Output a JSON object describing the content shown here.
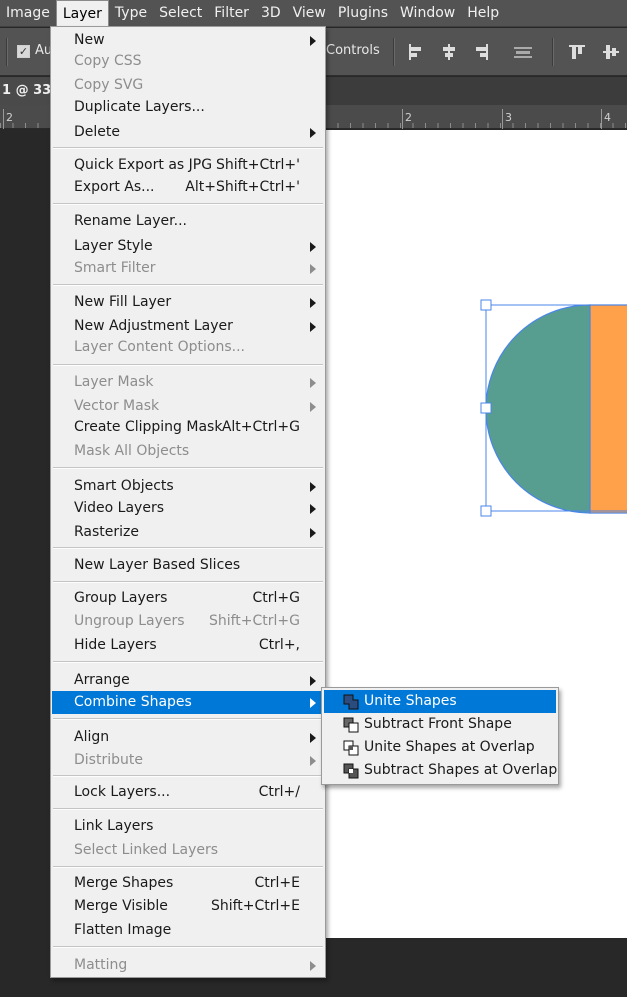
{
  "menubar": {
    "items": [
      "Image",
      "Layer",
      "Type",
      "Select",
      "Filter",
      "3D",
      "View",
      "Plugins",
      "Window",
      "Help"
    ],
    "active_index": 1
  },
  "options_bar": {
    "auto_select_label": "Au",
    "auto_select_checked": true,
    "transform_controls_label": "Controls"
  },
  "document": {
    "tab_title": "1 @ 33."
  },
  "ruler": {
    "labels": [
      "2",
      "2",
      "3",
      "4"
    ]
  },
  "layer_menu": {
    "items": [
      {
        "label": "New",
        "submenu": true
      },
      {
        "label": "Copy CSS",
        "disabled": true
      },
      {
        "label": "Copy SVG",
        "disabled": true
      },
      {
        "label": "Duplicate Layers..."
      },
      {
        "label": "Delete",
        "submenu": true
      },
      {
        "label": "Quick Export as JPG",
        "shortcut": "Shift+Ctrl+'"
      },
      {
        "label": "Export As...",
        "shortcut": "Alt+Shift+Ctrl+'"
      },
      {
        "label": "Rename Layer..."
      },
      {
        "label": "Layer Style",
        "submenu": true
      },
      {
        "label": "Smart Filter",
        "submenu": true,
        "disabled": true
      },
      {
        "label": "New Fill Layer",
        "submenu": true
      },
      {
        "label": "New Adjustment Layer",
        "submenu": true
      },
      {
        "label": "Layer Content Options...",
        "disabled": true
      },
      {
        "label": "Layer Mask",
        "submenu": true,
        "disabled": true
      },
      {
        "label": "Vector Mask",
        "submenu": true,
        "disabled": true
      },
      {
        "label": "Create Clipping Mask",
        "shortcut": "Alt+Ctrl+G"
      },
      {
        "label": "Mask All Objects",
        "disabled": true
      },
      {
        "label": "Smart Objects",
        "submenu": true
      },
      {
        "label": "Video Layers",
        "submenu": true
      },
      {
        "label": "Rasterize",
        "submenu": true
      },
      {
        "label": "New Layer Based Slices"
      },
      {
        "label": "Group Layers",
        "shortcut": "Ctrl+G"
      },
      {
        "label": "Ungroup Layers",
        "shortcut": "Shift+Ctrl+G",
        "disabled": true
      },
      {
        "label": "Hide Layers",
        "shortcut": "Ctrl+,"
      },
      {
        "label": "Arrange",
        "submenu": true
      },
      {
        "label": "Combine Shapes",
        "submenu": true,
        "highlighted": true
      },
      {
        "label": "Align",
        "submenu": true
      },
      {
        "label": "Distribute",
        "submenu": true,
        "disabled": true
      },
      {
        "label": "Lock Layers...",
        "shortcut": "Ctrl+/"
      },
      {
        "label": "Link Layers"
      },
      {
        "label": "Select Linked Layers",
        "disabled": true
      },
      {
        "label": "Merge Shapes",
        "shortcut": "Ctrl+E"
      },
      {
        "label": "Merge Visible",
        "shortcut": "Shift+Ctrl+E"
      },
      {
        "label": "Flatten Image"
      },
      {
        "label": "Matting",
        "submenu": true,
        "disabled": true
      }
    ]
  },
  "combine_shapes_submenu": {
    "items": [
      {
        "label": "Unite Shapes",
        "icon": "unite-shapes-icon",
        "highlighted": true
      },
      {
        "label": "Subtract Front Shape",
        "icon": "subtract-front-shape-icon"
      },
      {
        "label": "Unite Shapes at Overlap",
        "icon": "unite-at-overlap-icon"
      },
      {
        "label": "Subtract Shapes at Overlap",
        "icon": "subtract-at-overlap-icon"
      }
    ]
  },
  "colors": {
    "highlight": "#0078d7",
    "teal_shape": "#579e91",
    "orange_shape": "#ffa04a",
    "selection_blue": "#4a86e8"
  }
}
